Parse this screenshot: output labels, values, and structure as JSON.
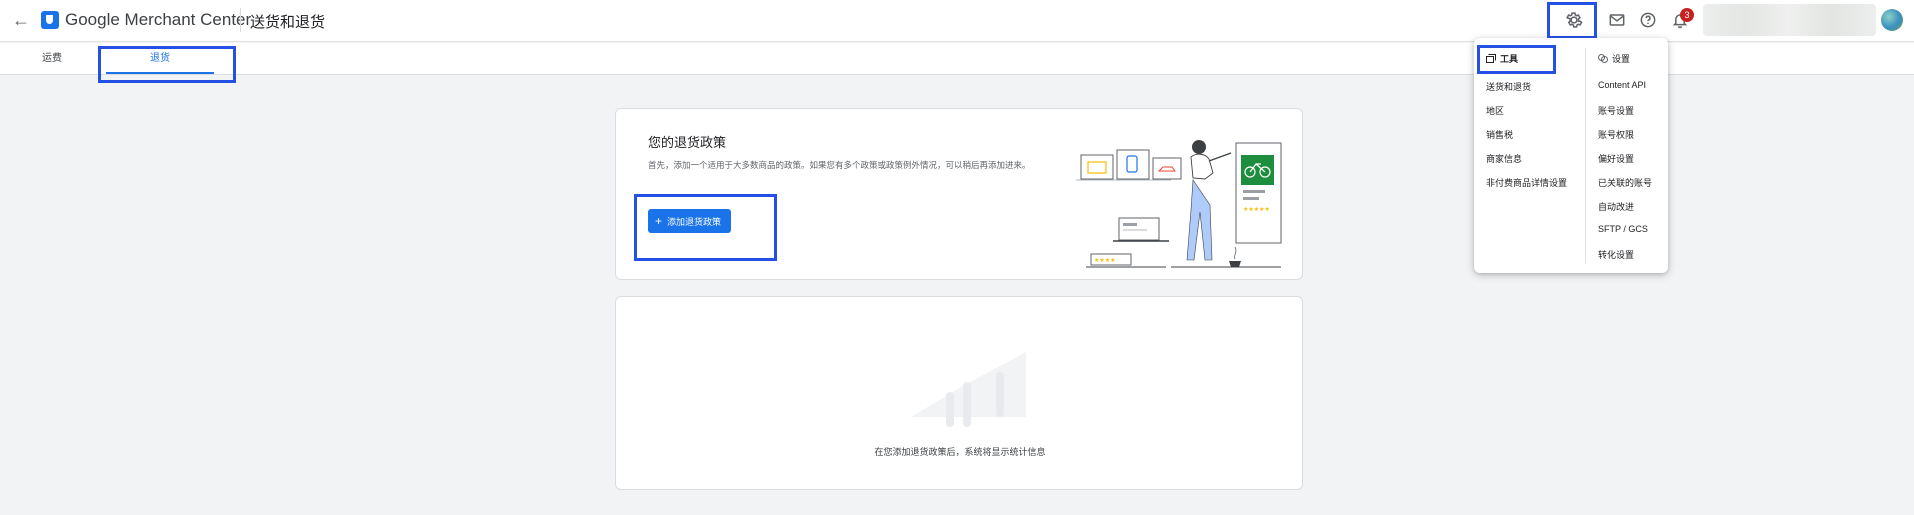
{
  "header": {
    "back_label": "←",
    "brand": "Google Merchant Center",
    "page_title": "送货和退货",
    "notification_count": "3"
  },
  "tabs": [
    {
      "label": "运费",
      "active": false
    },
    {
      "label": "退货",
      "active": true
    }
  ],
  "policy_card": {
    "title": "您的退货政策",
    "description": "首先，添加一个适用于大多数商品的政策。如果您有多个政策或政策例外情况，可以稍后再添加进来。",
    "add_button_label": "添加退货政策"
  },
  "stats_card": {
    "empty_message": "在您添加退货政策后，系统将显示统计信息"
  },
  "menu": {
    "tools_label": "工具",
    "settings_label": "设置",
    "tools_items": [
      "送货和退货",
      "地区",
      "销售税",
      "商家信息",
      "非付费商品详情设置"
    ],
    "settings_items": [
      "Content API",
      "账号设置",
      "账号权限",
      "偏好设置",
      "已关联的账号",
      "自动改进",
      "SFTP / GCS",
      "转化设置"
    ]
  },
  "colors": {
    "accent": "#1a73e8",
    "highlight": "#2450e6",
    "badge": "#c5221f"
  }
}
